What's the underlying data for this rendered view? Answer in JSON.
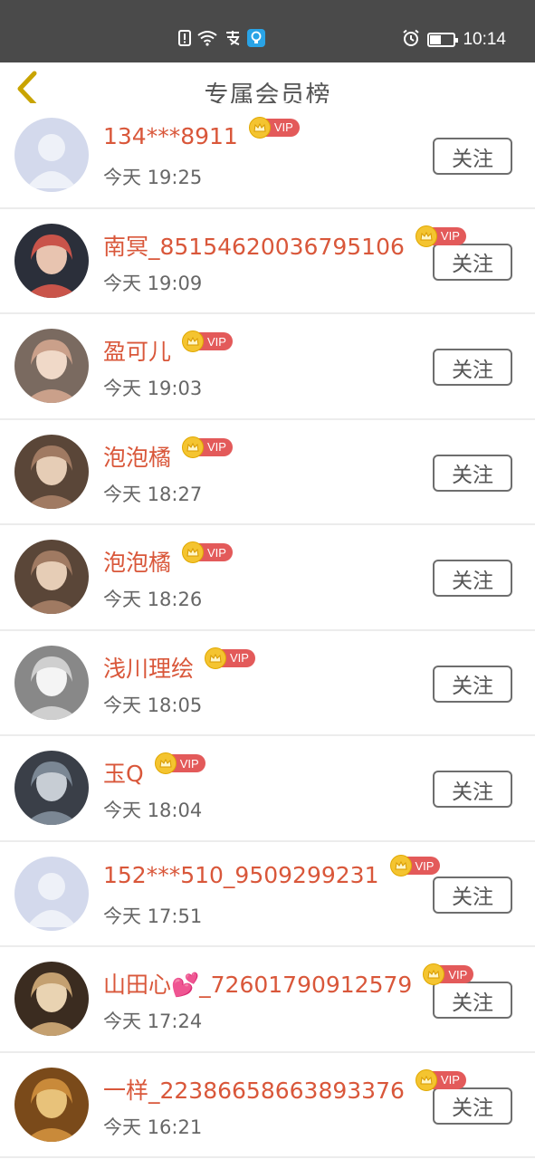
{
  "status_bar": {
    "time": "10:14",
    "battery_level": 0.45,
    "icons": [
      "sim-alert-icon",
      "wifi-icon",
      "alipay-icon",
      "app-notification-icon",
      "alarm-icon",
      "battery-icon"
    ]
  },
  "header": {
    "title": "专属会员榜",
    "back_icon": "chevron-left-icon"
  },
  "colors": {
    "name": "#d9573a",
    "vip": "#e35a5a",
    "crown": "#f4c430",
    "back": "#c9a400"
  },
  "vip_label": "VIP",
  "follow_label": "关注",
  "members": [
    {
      "name": "134***8911",
      "time": "今天 19:25",
      "avatar": "default-avatar"
    },
    {
      "name": "南冥_85154620036795106",
      "time": "今天 19:09",
      "avatar": "photo-avatar"
    },
    {
      "name": "盈可儿",
      "time": "今天 19:03",
      "avatar": "photo-avatar"
    },
    {
      "name": "泡泡橘",
      "time": "今天 18:27",
      "avatar": "photo-avatar"
    },
    {
      "name": "泡泡橘",
      "time": "今天 18:26",
      "avatar": "photo-avatar"
    },
    {
      "name": "浅川理绘",
      "time": "今天 18:05",
      "avatar": "photo-avatar"
    },
    {
      "name": "玉Q",
      "time": "今天 18:04",
      "avatar": "photo-avatar"
    },
    {
      "name": "152***510_9509299231",
      "time": "今天 17:51",
      "avatar": "default-avatar"
    },
    {
      "name": "山田心💕_72601790912579",
      "time": "今天 17:24",
      "avatar": "photo-avatar"
    },
    {
      "name": "一样_22386658663893376",
      "time": "今天 16:21",
      "avatar": "photo-avatar"
    }
  ]
}
